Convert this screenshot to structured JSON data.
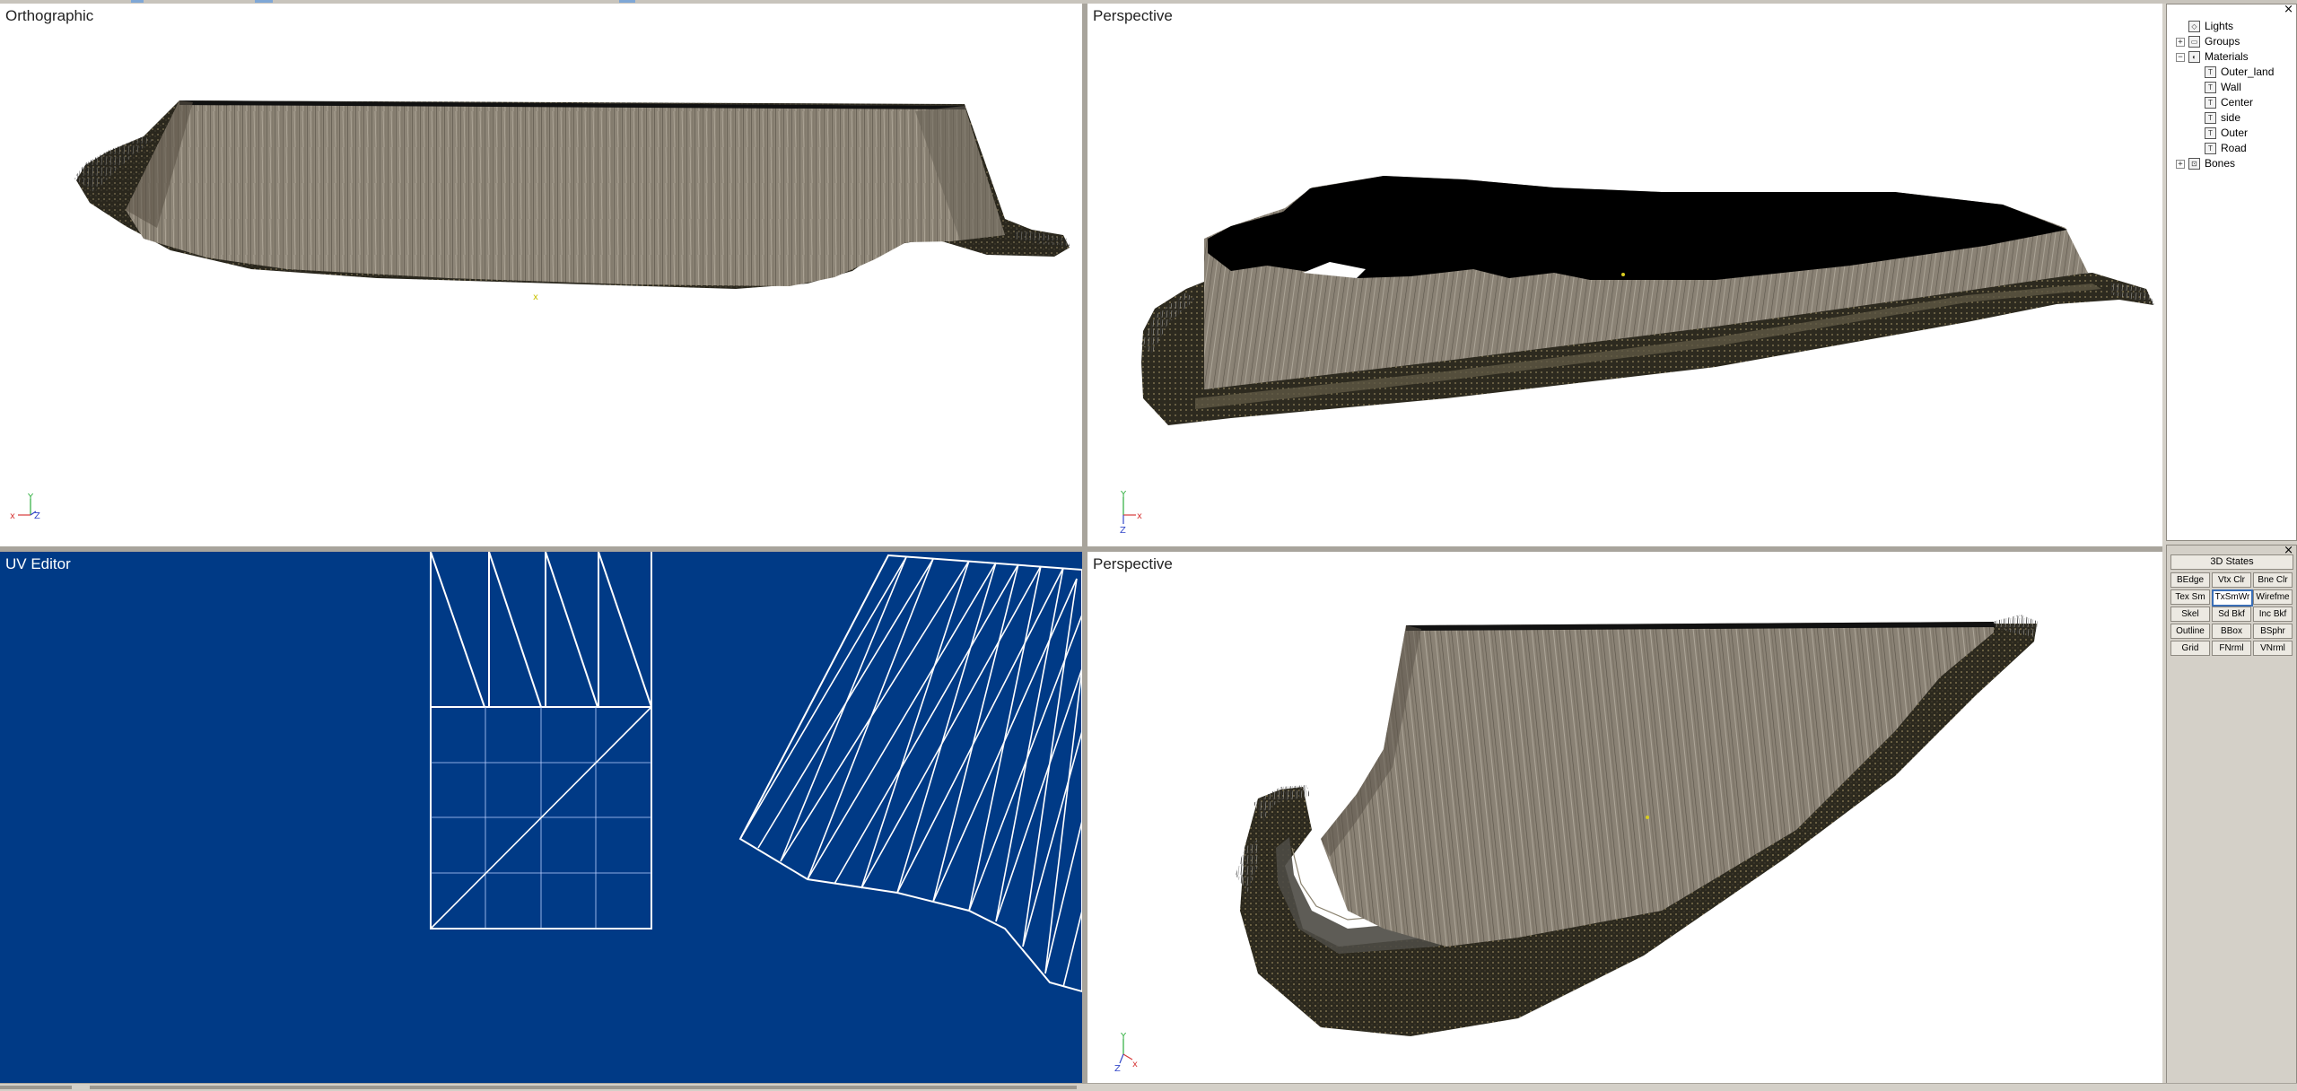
{
  "viewports": {
    "top_left": {
      "label": "Orthographic"
    },
    "top_right": {
      "label": "Perspective"
    },
    "bottom_left": {
      "label": "UV Editor"
    },
    "bottom_right": {
      "label": "Perspective"
    }
  },
  "axes": {
    "x": "x",
    "y": "y",
    "z": "z"
  },
  "scene_tree": {
    "close": "×",
    "items": [
      {
        "label": "Lights",
        "icon": "light-icon",
        "level": 0,
        "expander": ""
      },
      {
        "label": "Groups",
        "icon": "group-icon",
        "level": 0,
        "expander": "+"
      },
      {
        "label": "Materials",
        "icon": "material-icon",
        "level": 0,
        "expander": "−"
      },
      {
        "label": "Outer_land",
        "icon": "texture-icon",
        "level": 1,
        "expander": ""
      },
      {
        "label": "Wall",
        "icon": "texture-icon",
        "level": 1,
        "expander": ""
      },
      {
        "label": "Center",
        "icon": "texture-icon",
        "level": 1,
        "expander": ""
      },
      {
        "label": "side",
        "icon": "texture-icon",
        "level": 1,
        "expander": ""
      },
      {
        "label": "Outer",
        "icon": "texture-icon",
        "level": 1,
        "expander": ""
      },
      {
        "label": "Road",
        "icon": "texture-icon",
        "level": 1,
        "expander": ""
      },
      {
        "label": "Bones",
        "icon": "bone-icon",
        "level": 0,
        "expander": "+"
      }
    ]
  },
  "states_panel": {
    "close": "×",
    "title": "3D States",
    "buttons": [
      [
        "BEdge",
        "Vtx Clr",
        "Bne Clr"
      ],
      [
        "Tex Sm",
        "TxSmWr",
        "Wirefme"
      ],
      [
        "Skel",
        "Sd Bkf",
        "Inc Bkf"
      ],
      [
        "Outline",
        "BBox",
        "BSphr"
      ],
      [
        "Grid",
        "FNrml",
        "VNrml"
      ]
    ],
    "active_button": "TxSmWr"
  },
  "colors": {
    "uv_background": "#003a86",
    "viewport_background": "#ffffff",
    "wall_texture": "#8a8275",
    "ground_texture": "#2d2a1f"
  }
}
